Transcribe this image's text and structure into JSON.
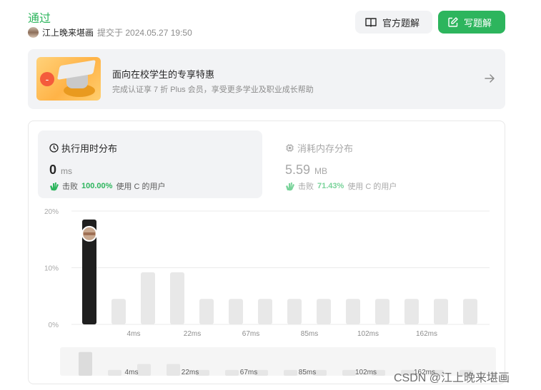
{
  "header": {
    "status": "通过",
    "author": "江上晚来堪画",
    "submitted": "提交于 2024.05.27 19:50",
    "official_solution_label": "官方题解",
    "write_solution_label": "写题解"
  },
  "promo": {
    "title": "面向在校学生的专享特惠",
    "subtitle": "完成认证享 7 折 Plus 会员，享受更多学业及职业成长帮助"
  },
  "runtime": {
    "label": "执行用时分布",
    "value": "0",
    "unit": "ms",
    "beat_prefix": "击败",
    "beat_pct": "100.00%",
    "beat_suffix": "使用 C 的用户"
  },
  "memory": {
    "label": "消耗内存分布",
    "value": "5.59",
    "unit": "MB",
    "beat_prefix": "击败",
    "beat_pct": "71.43%",
    "beat_suffix": "使用 C 的用户"
  },
  "chart_data": {
    "type": "bar",
    "categories": [
      "0ms",
      "",
      "4ms",
      "",
      "22ms",
      "",
      "67ms",
      "",
      "85ms",
      "",
      "102ms",
      "",
      "162ms",
      ""
    ],
    "values": [
      18.5,
      4.5,
      9.2,
      9.2,
      4.5,
      4.5,
      4.5,
      4.5,
      4.5,
      4.5,
      4.5,
      4.5,
      4.5,
      4.5
    ],
    "highlight_index": 0,
    "ylim": [
      0,
      20
    ],
    "yticks": [
      "0%",
      "10%",
      "20%"
    ],
    "xtick_labels": [
      "4ms",
      "22ms",
      "67ms",
      "85ms",
      "102ms",
      "162ms"
    ],
    "grid": true,
    "colors": {
      "highlight": "#1f1f1f",
      "bar": "#e8e8e8",
      "grid": "#ebebeb"
    }
  },
  "minimap_labels": [
    "4ms",
    "22ms",
    "67ms",
    "85ms",
    "102ms",
    "162ms"
  ],
  "watermark": "CSDN @江上晚来堪画",
  "colors": {
    "accent": "#2db55d",
    "panel": "#f2f3f5"
  }
}
